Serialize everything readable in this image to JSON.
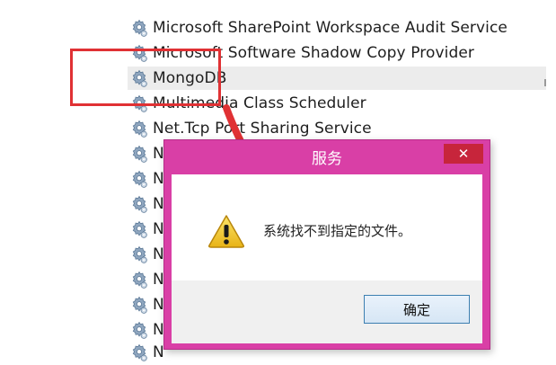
{
  "services": [
    {
      "name": "Microsoft SharePoint Workspace Audit Service",
      "selected": false,
      "icon": "gear-icon"
    },
    {
      "name": "Microsoft Software Shadow Copy Provider",
      "selected": false,
      "icon": "gear-icon"
    },
    {
      "name": "MongoDB",
      "selected": true,
      "icon": "gear-icon"
    },
    {
      "name": "Multimedia Class Scheduler",
      "selected": false,
      "icon": "gear-icon"
    },
    {
      "name": "Net.Tcp Port Sharing Service",
      "selected": false,
      "icon": "gear-icon"
    },
    {
      "name": "N",
      "selected": false,
      "icon": "gear-icon"
    },
    {
      "name": "N",
      "selected": false,
      "icon": "gear-icon"
    },
    {
      "name": "N",
      "selected": false,
      "icon": "gear-icon"
    },
    {
      "name": "N",
      "selected": false,
      "icon": "gear-icon"
    },
    {
      "name": "N",
      "selected": false,
      "icon": "gear-icon"
    },
    {
      "name": "N",
      "selected": false,
      "icon": "gear-icon"
    },
    {
      "name": "N",
      "selected": false,
      "icon": "gear-icon"
    },
    {
      "name": "N",
      "selected": false,
      "icon": "gear-icon"
    },
    {
      "name": "N",
      "selected": false,
      "icon": "gear-icon"
    }
  ],
  "dialog": {
    "title": "服务",
    "close_label": "✕",
    "message": "系统找不到指定的文件。",
    "ok_label": "确定",
    "icon": "warning-icon"
  },
  "colors": {
    "highlight": "#e03134",
    "dialog_frame": "#d93fa6",
    "close_button": "#c7253b"
  }
}
